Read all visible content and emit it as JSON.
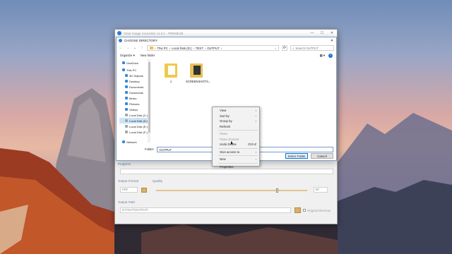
{
  "app": {
    "title": "Clear Image Converter v1.0.1 - PREMIUM",
    "window_controls": [
      "—",
      "☐",
      "✕"
    ],
    "lower": {
      "progress_label": "Progress",
      "output_format_label": "Output Format",
      "quality_label": "Quality",
      "format_value": "PDF",
      "quality_value": "80",
      "quality_level": 0.8,
      "output_path_label": "Output Path",
      "output_path_value": "D:\\TEST\\OUTPUT\\",
      "original_directory_label": "Original Directory"
    }
  },
  "dialog": {
    "title": "CHOOSE DIRECTORY",
    "close": "✕",
    "nav": {
      "back": "←",
      "forward": "→",
      "up_dropdown": "⌄",
      "up": "↑"
    },
    "breadcrumb": [
      "This PC",
      "Local Disk (D:)",
      "TEST",
      "OUTPUT"
    ],
    "breadcrumb_sep": "›",
    "refresh": "⟳",
    "search_placeholder": "Search OUTPUT",
    "commands": {
      "organize": "Organize ▾",
      "new_folder": "New folder"
    },
    "nav_pane": [
      {
        "label": "OneDrive",
        "kind": "cloud",
        "selected": false,
        "indent": false
      },
      {
        "label": "This PC",
        "kind": "pc",
        "selected": false,
        "indent": false
      },
      {
        "label": "3D Objects",
        "kind": "folder",
        "selected": false,
        "indent": true
      },
      {
        "label": "Desktop",
        "kind": "folder",
        "selected": false,
        "indent": true
      },
      {
        "label": "Documents",
        "kind": "folder",
        "selected": false,
        "indent": true
      },
      {
        "label": "Downloads",
        "kind": "folder",
        "selected": false,
        "indent": true
      },
      {
        "label": "Music",
        "kind": "folder",
        "selected": false,
        "indent": true
      },
      {
        "label": "Pictures",
        "kind": "folder",
        "selected": false,
        "indent": true
      },
      {
        "label": "Videos",
        "kind": "folder",
        "selected": false,
        "indent": true
      },
      {
        "label": "Local Disk (C:)",
        "kind": "drive",
        "selected": false,
        "indent": true
      },
      {
        "label": "Local Disk (D:)",
        "kind": "drive",
        "selected": true,
        "indent": true
      },
      {
        "label": "Local Disk (E:)",
        "kind": "drive",
        "selected": false,
        "indent": true
      },
      {
        "label": "Local Disk (F:)",
        "kind": "drive",
        "selected": false,
        "indent": true
      },
      {
        "label": "Network",
        "kind": "network",
        "selected": false,
        "indent": false
      }
    ],
    "files": [
      {
        "name": "1",
        "type": "folder-with-docs"
      },
      {
        "name": "SCREENSHOTS...",
        "type": "folder-with-images"
      }
    ],
    "folder_label": "Folder:",
    "folder_value": "OUTPUT",
    "select_button": "Select Folder",
    "cancel_button": "Cancel"
  },
  "context_menu": {
    "items": [
      {
        "label": "View",
        "submenu": true,
        "disabled": false
      },
      {
        "label": "Sort by",
        "submenu": true,
        "disabled": false
      },
      {
        "label": "Group by",
        "submenu": true,
        "disabled": false
      },
      {
        "label": "Refresh",
        "submenu": false,
        "disabled": false
      },
      {
        "sep": true
      },
      {
        "label": "Paste",
        "submenu": false,
        "disabled": true
      },
      {
        "label": "Paste shortcut",
        "submenu": false,
        "disabled": true
      },
      {
        "label": "Undo Delete",
        "shortcut": "Ctrl+Z",
        "submenu": false,
        "disabled": false
      },
      {
        "sep": true
      },
      {
        "label": "Give access to",
        "submenu": true,
        "disabled": false
      },
      {
        "sep": true
      },
      {
        "label": "New",
        "submenu": true,
        "disabled": false
      },
      {
        "sep": true
      },
      {
        "label": "Properties",
        "submenu": false,
        "disabled": false
      }
    ]
  }
}
